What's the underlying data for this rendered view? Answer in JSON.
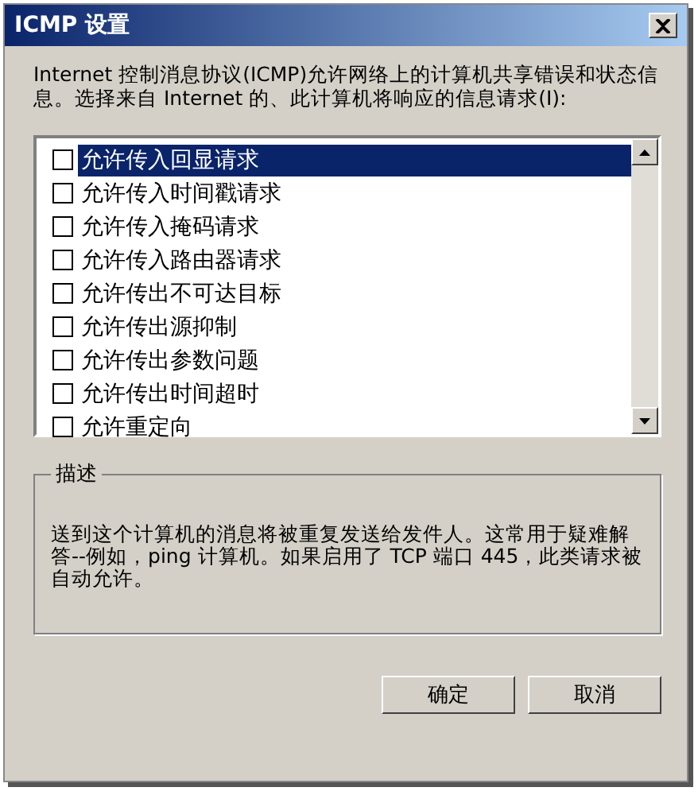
{
  "window": {
    "title": "ICMP 设置"
  },
  "intro": "Internet 控制消息协议(ICMP)允许网络上的计算机共享错误和状态信息。选择来自 Internet 的、此计算机将响应的信息请求(I):",
  "options": [
    {
      "label": "允许传入回显请求",
      "checked": false,
      "selected": true
    },
    {
      "label": "允许传入时间戳请求",
      "checked": false,
      "selected": false
    },
    {
      "label": "允许传入掩码请求",
      "checked": false,
      "selected": false
    },
    {
      "label": "允许传入路由器请求",
      "checked": false,
      "selected": false
    },
    {
      "label": "允许传出不可达目标",
      "checked": false,
      "selected": false
    },
    {
      "label": "允许传出源抑制",
      "checked": false,
      "selected": false
    },
    {
      "label": "允许传出参数问题",
      "checked": false,
      "selected": false
    },
    {
      "label": "允许传出时间超时",
      "checked": false,
      "selected": false
    },
    {
      "label": "允许重定向",
      "checked": false,
      "selected": false
    }
  ],
  "description": {
    "title": "描述",
    "text": "送到这个计算机的消息将被重复发送给发件人。这常用于疑难解答--例如，ping 计算机。如果启用了 TCP 端口 445，此类请求被自动允许。"
  },
  "buttons": [
    "确定",
    "取消"
  ]
}
